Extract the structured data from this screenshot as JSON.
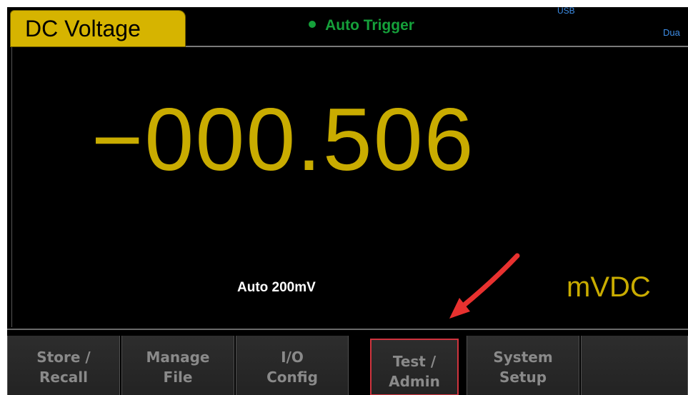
{
  "header": {
    "title": "DC Voltage",
    "trigger_mode": "Auto Trigger",
    "usb_label": "USB",
    "dual_label": "Dua"
  },
  "display": {
    "reading": "−000.506",
    "range": "Auto 200mV",
    "unit": "mVDC"
  },
  "softkeys": [
    {
      "line1": "Store /",
      "line2": "Recall"
    },
    {
      "line1": "Manage",
      "line2": "File"
    },
    {
      "line1": "I/O",
      "line2": "Config"
    },
    {
      "line1": "Test /",
      "line2": "Admin",
      "highlighted": true
    },
    {
      "line1": "System",
      "line2": "Setup"
    },
    {
      "line1": "",
      "line2": ""
    }
  ],
  "colors": {
    "accent_yellow": "#d6b400",
    "reading_yellow": "#c9ac00",
    "trigger_green": "#15a03a",
    "usb_blue": "#3d8ee8",
    "annotation_red": "#e8312f"
  },
  "icons": {
    "trigger_status": "dot-icon",
    "annotation": "arrow-icon"
  }
}
